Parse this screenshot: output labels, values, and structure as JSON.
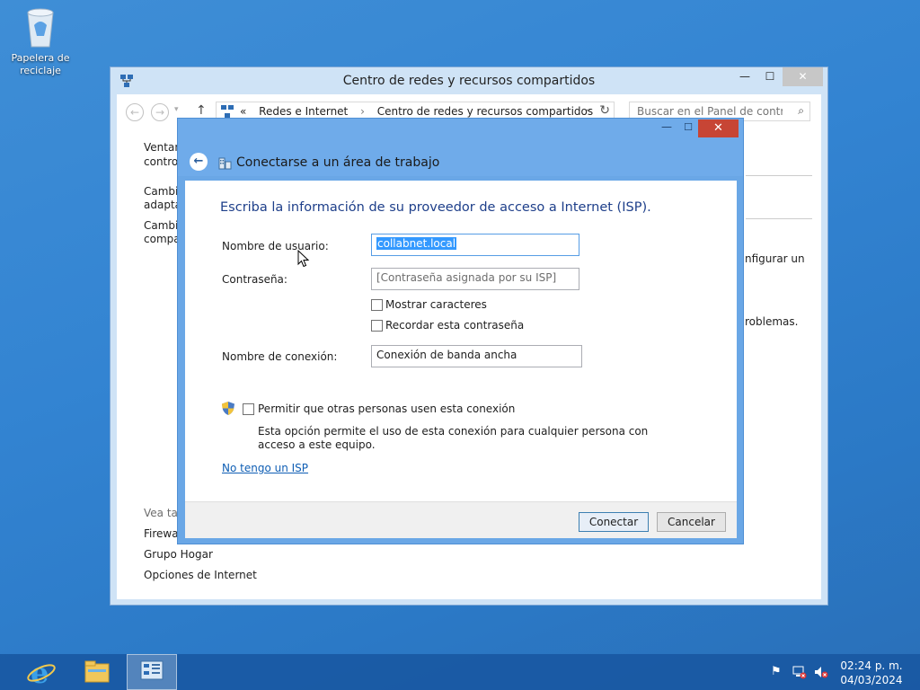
{
  "desktop": {
    "recycle_bin_label": "Papelera de reciclaje"
  },
  "window": {
    "title": "Centro de redes y recursos compartidos",
    "minimize": "—",
    "maximize": "☐",
    "close": "✕",
    "address": {
      "prefix": "«",
      "crumbs": [
        "Redes e Internet",
        "Centro de redes y recursos compartidos"
      ]
    },
    "search_placeholder": "Buscar en el Panel de control",
    "sidebar": {
      "item1_line1": "Ventana",
      "item1_line2": "control",
      "item2_line1": "Cambia",
      "item2_line2": "adaptad",
      "item3_line1": "Cambia",
      "item3_line2": "compar",
      "see_also": "Vea tam",
      "links": [
        "Firewall",
        "Grupo Hogar",
        "Opciones de Internet"
      ]
    },
    "main_right": {
      "text1": "nfigurar un",
      "text2": "roblemas."
    }
  },
  "dialog": {
    "minimize": "—",
    "maximize": "☐",
    "close": "✕",
    "title": "Conectarse a un área de trabajo",
    "heading": "Escriba la información de su proveedor de acceso a Internet (ISP).",
    "username_label": "Nombre de usuario:",
    "username_value": "collabnet.local",
    "password_label": "Contraseña:",
    "password_placeholder": "[Contraseña asignada por su ISP]",
    "show_chars_label": "Mostrar caracteres",
    "remember_label": "Recordar esta contraseña",
    "connection_name_label": "Nombre de conexión:",
    "connection_name_value": "Conexión de banda ancha",
    "allow_others_label": "Permitir que otras personas usen esta conexión",
    "allow_others_desc": "Esta opción permite el uso de esta conexión para cualquier persona con acceso a este equipo.",
    "no_isp_link": "No tengo un ISP",
    "connect_button": "Conectar",
    "cancel_button": "Cancelar"
  },
  "taskbar": {
    "time": "02:24 p. m.",
    "date": "04/03/2024"
  }
}
